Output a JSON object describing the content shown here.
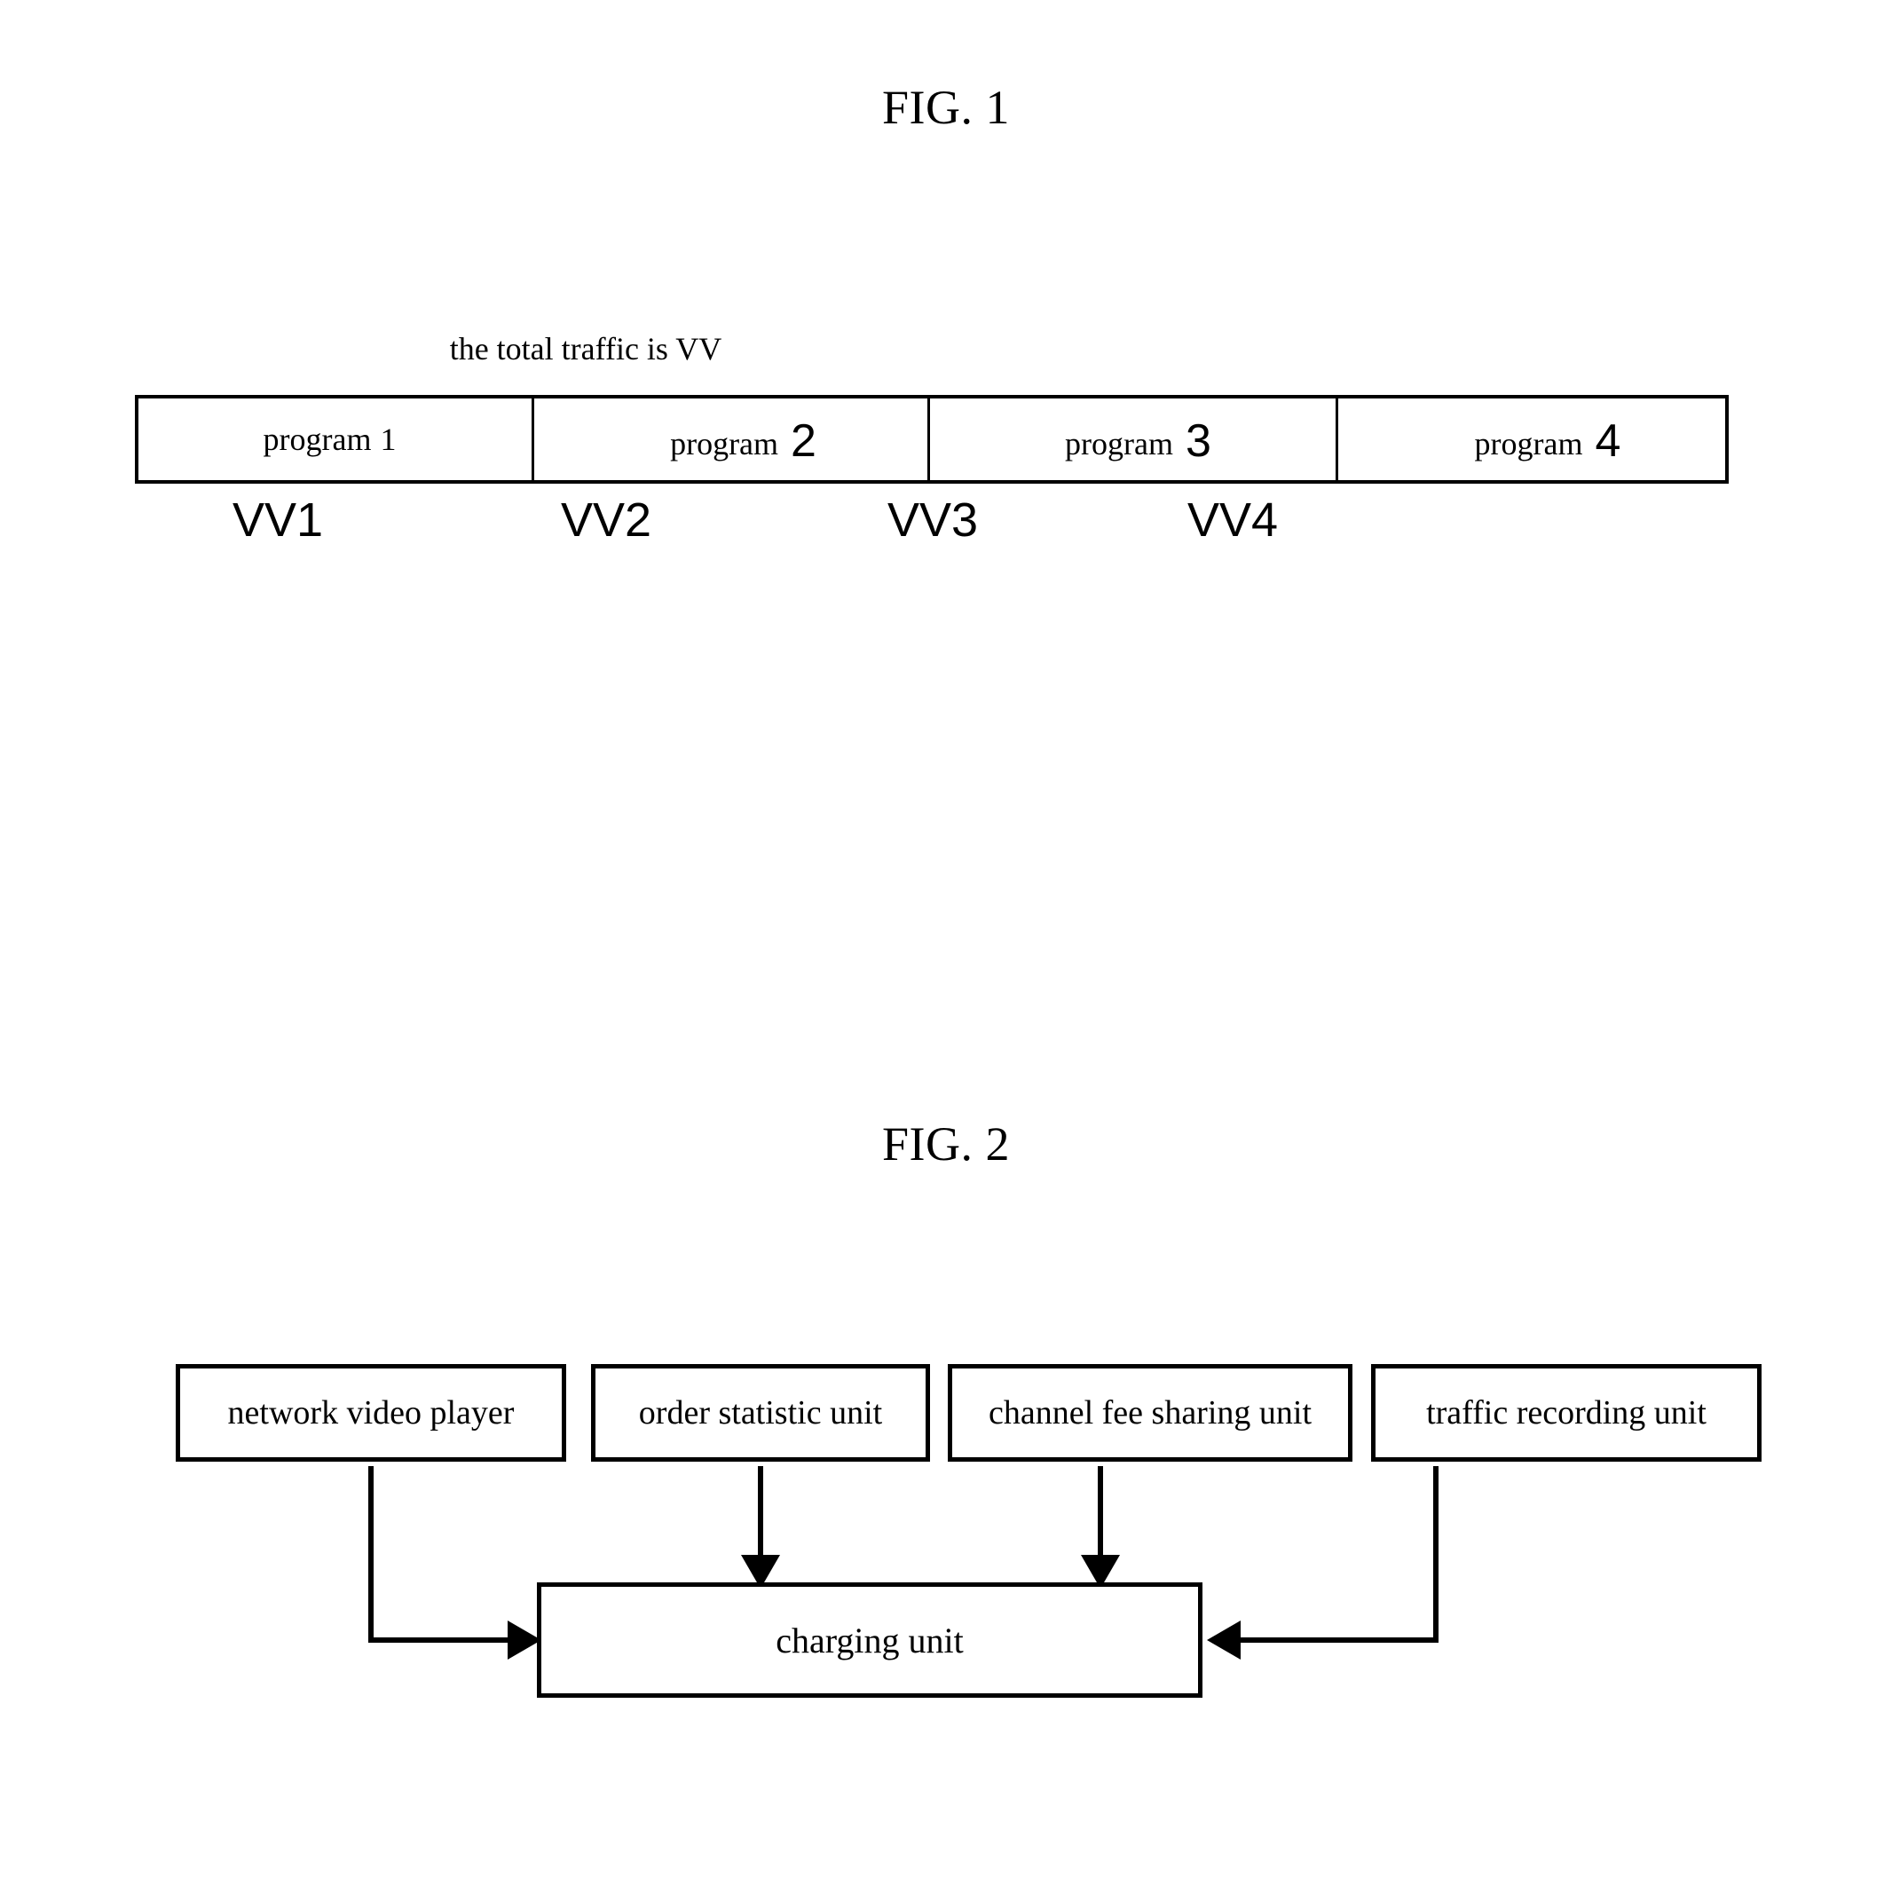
{
  "figures": [
    {
      "id": "fig1",
      "title": "FIG. 1",
      "caption": "the total traffic is VV",
      "cells": [
        {
          "word": "program",
          "number": "1",
          "number_style": "normal"
        },
        {
          "word": "program",
          "number": "2",
          "number_style": "large"
        },
        {
          "word": "program",
          "number": "3",
          "number_style": "large"
        },
        {
          "word": "program",
          "number": "4",
          "number_style": "large"
        }
      ],
      "traffic_labels": [
        "VV1",
        "VV2",
        "VV3",
        "VV4"
      ]
    },
    {
      "id": "fig2",
      "title": "FIG. 2",
      "boxes": {
        "player": "network video player",
        "order": "order statistic unit",
        "channel": "channel fee sharing unit",
        "traffic": "traffic recording unit",
        "charging": "charging unit"
      },
      "connections": [
        {
          "from": "network video player",
          "to": "charging unit",
          "route": "elbow-left"
        },
        {
          "from": "order statistic unit",
          "to": "charging unit",
          "route": "straight-down"
        },
        {
          "from": "channel fee sharing unit",
          "to": "charging unit",
          "route": "straight-down"
        },
        {
          "from": "traffic recording unit",
          "to": "charging unit",
          "route": "elbow-right"
        }
      ]
    }
  ],
  "colors": {
    "line": "#000000",
    "background": "#ffffff"
  }
}
